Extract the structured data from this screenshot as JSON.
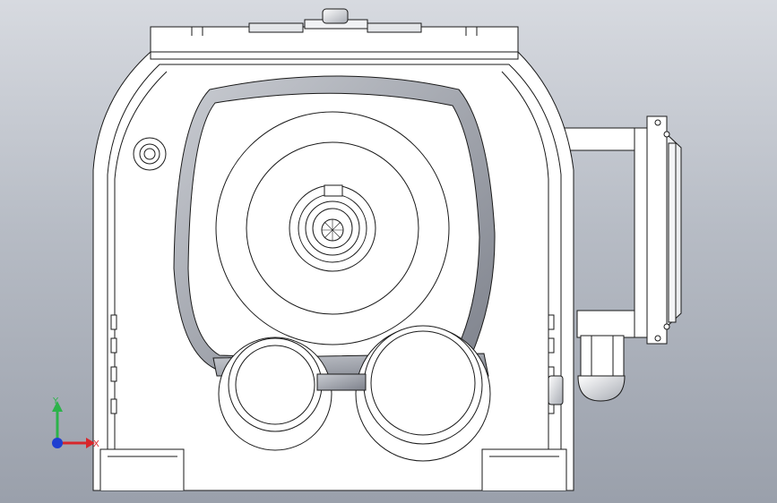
{
  "viewport": {
    "background_top": "#d7dae0",
    "background_bottom": "#9aa0ab"
  },
  "model": {
    "description_type": "gear reducer housing, front view",
    "line_color": "#1a1a1a",
    "body_fill": "#ffffff",
    "shade_fill": "#9a9ea8"
  },
  "triad": {
    "x_label": "X",
    "y_label": "Y",
    "x_color": "#d8262b",
    "y_color": "#2cb34a",
    "z_color": "#1f3fd1"
  }
}
